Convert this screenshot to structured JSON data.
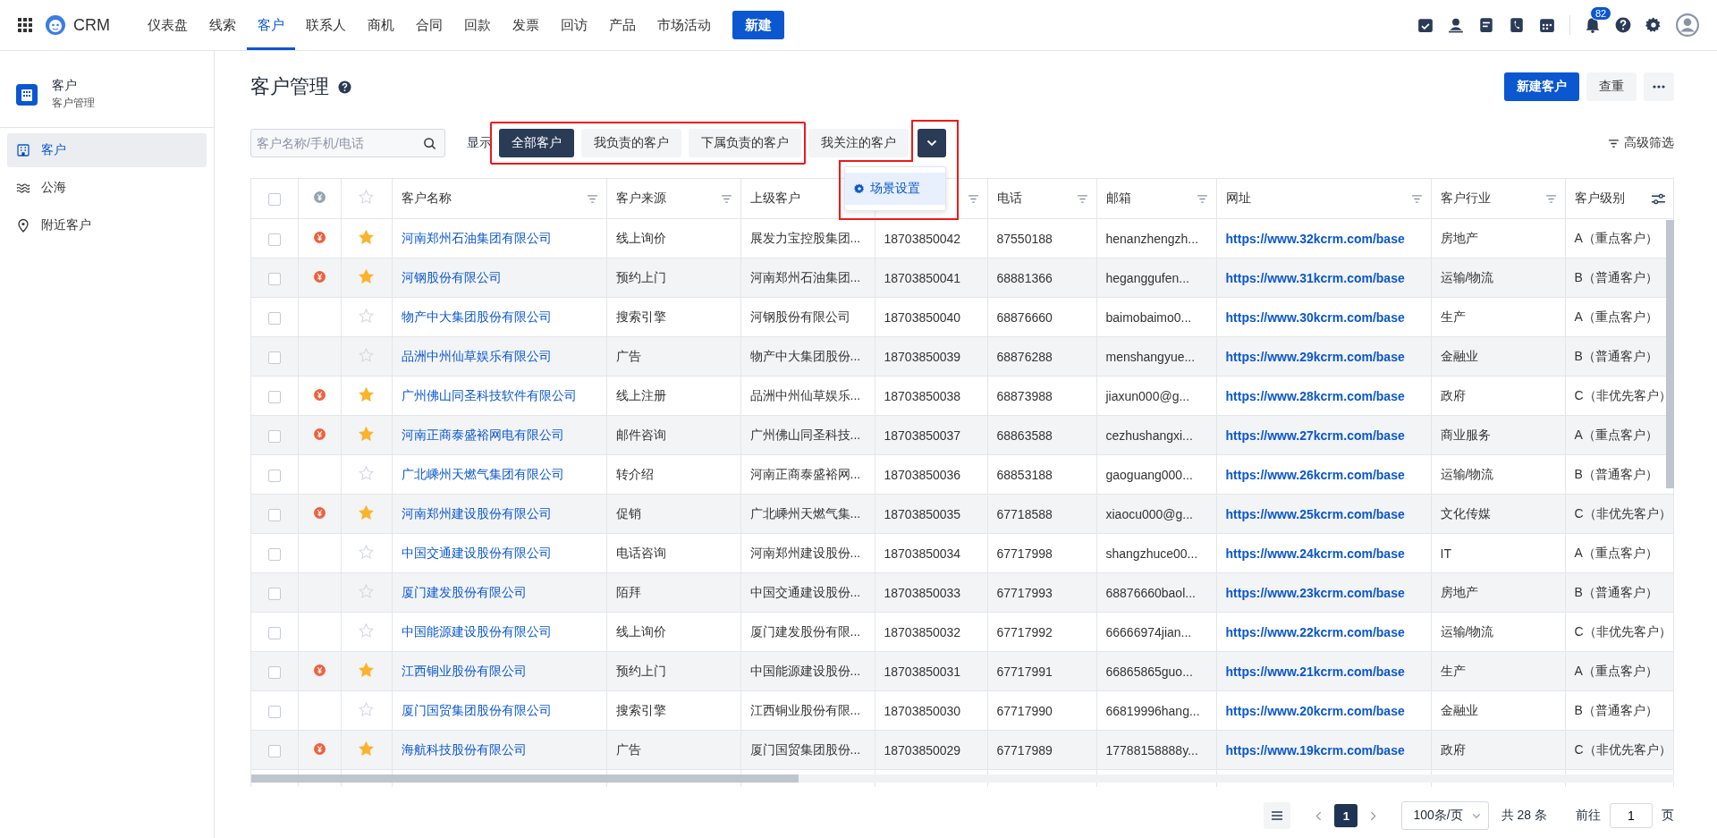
{
  "topbar": {
    "brand": "CRM",
    "nav": [
      {
        "label": "仪表盘",
        "selected": false
      },
      {
        "label": "线索",
        "selected": false
      },
      {
        "label": "客户",
        "selected": true
      },
      {
        "label": "联系人",
        "selected": false
      },
      {
        "label": "商机",
        "selected": false
      },
      {
        "label": "合同",
        "selected": false
      },
      {
        "label": "回款",
        "selected": false
      },
      {
        "label": "发票",
        "selected": false
      },
      {
        "label": "回访",
        "selected": false
      },
      {
        "label": "产品",
        "selected": false
      },
      {
        "label": "市场活动",
        "selected": false
      }
    ],
    "create_button": "新建",
    "notification_count": "82"
  },
  "sidebar": {
    "title": "客户",
    "subtitle": "客户管理",
    "items": [
      {
        "label": "客户",
        "kind": "building",
        "selected": true
      },
      {
        "label": "公海",
        "kind": "waves",
        "selected": false
      },
      {
        "label": "附近客户",
        "kind": "pin",
        "selected": false
      }
    ]
  },
  "header": {
    "title": "客户管理",
    "buttons": [
      {
        "label": "新建客户",
        "kind": "primary"
      },
      {
        "label": "查重",
        "kind": "plain"
      }
    ]
  },
  "filters": {
    "search_placeholder": "客户名称/手机/电话",
    "show_label": "显示",
    "scenes": [
      {
        "label": "全部客户",
        "selected": true
      },
      {
        "label": "我负责的客户",
        "selected": false
      },
      {
        "label": "下属负责的客户",
        "selected": false
      },
      {
        "label": "我关注的客户",
        "selected": false
      }
    ],
    "scene_menu": [
      "场景设置"
    ],
    "advanced_filter": "高级筛选"
  },
  "table": {
    "select_all_checked": false,
    "columns": [
      {
        "label": "客户名称",
        "filter": true
      },
      {
        "label": "客户来源",
        "filter": true
      },
      {
        "label": "上级客户",
        "filter": false
      },
      {
        "filter": true
      },
      {
        "label": "电话",
        "filter": true
      },
      {
        "label": "邮箱",
        "filter": true
      },
      {
        "label": "网址",
        "filter": true
      },
      {
        "label": "客户行业",
        "filter": true
      },
      {
        "label": "客户级别",
        "filter": false
      }
    ],
    "rows": [
      {
        "checked": false,
        "deal": true,
        "starred": true,
        "cells": [
          "河南郑州石油集团有限公司",
          "线上询价",
          "展发力宝控股集团...",
          "18703850042",
          "87550188",
          "henanzhengzh...",
          "https://www.32kcrm.com/base",
          "房地产",
          "A（重点客户）"
        ]
      },
      {
        "checked": false,
        "deal": true,
        "starred": true,
        "cells": [
          "河钢股份有限公司",
          "预约上门",
          "河南郑州石油集团...",
          "18703850041",
          "68881366",
          "heganggufen...",
          "https://www.31kcrm.com/base",
          "运输/物流",
          "B（普通客户）"
        ]
      },
      {
        "checked": false,
        "deal": false,
        "starred": false,
        "cells": [
          "物产中大集团股份有限公司",
          "搜索引擎",
          "河钢股份有限公司",
          "18703850040",
          "68876660",
          "baimobaimo0...",
          "https://www.30kcrm.com/base",
          "生产",
          "A（重点客户）"
        ]
      },
      {
        "checked": false,
        "deal": false,
        "starred": false,
        "cells": [
          "品洲中州仙草娱乐有限公司",
          "广告",
          "物产中大集团股份...",
          "18703850039",
          "68876288",
          "menshangyue...",
          "https://www.29kcrm.com/base",
          "金融业",
          "B（普通客户）"
        ]
      },
      {
        "checked": false,
        "deal": true,
        "starred": true,
        "cells": [
          "广州佛山同圣科技软件有限公司",
          "线上注册",
          "品洲中州仙草娱乐...",
          "18703850038",
          "68873988",
          "jiaxun000@g...",
          "https://www.28kcrm.com/base",
          "政府",
          "C（非优先客户）"
        ]
      },
      {
        "checked": false,
        "deal": true,
        "starred": true,
        "cells": [
          "河南正商泰盛裕网电有限公司",
          "邮件咨询",
          "广州佛山同圣科技...",
          "18703850037",
          "68863588",
          "cezhushangxi...",
          "https://www.27kcrm.com/base",
          "商业服务",
          "A（重点客户）"
        ]
      },
      {
        "checked": false,
        "deal": false,
        "starred": false,
        "cells": [
          "广北嵊州天燃气集团有限公司",
          "转介绍",
          "河南正商泰盛裕网...",
          "18703850036",
          "68853188",
          "gaoguang000...",
          "https://www.26kcrm.com/base",
          "运输/物流",
          "B（普通客户）"
        ]
      },
      {
        "checked": false,
        "deal": true,
        "starred": true,
        "cells": [
          "河南郑州建设股份有限公司",
          "促销",
          "广北嵊州天燃气集...",
          "18703850035",
          "67718588",
          "xiaocu000@g...",
          "https://www.25kcrm.com/base",
          "文化传媒",
          "C（非优先客户）"
        ]
      },
      {
        "checked": false,
        "deal": false,
        "starred": false,
        "cells": [
          "中国交通建设股份有限公司",
          "电话咨询",
          "河南郑州建设股份...",
          "18703850034",
          "67717998",
          "shangzhuce00...",
          "https://www.24kcrm.com/base",
          "IT",
          "A（重点客户）"
        ]
      },
      {
        "checked": false,
        "deal": false,
        "starred": false,
        "cells": [
          "厦门建发股份有限公司",
          "陌拜",
          "中国交通建设股份...",
          "18703850033",
          "67717993",
          "68876660baol...",
          "https://www.23kcrm.com/base",
          "房地产",
          "B（普通客户）"
        ]
      },
      {
        "checked": false,
        "deal": false,
        "starred": false,
        "cells": [
          "中国能源建设股份有限公司",
          "线上询价",
          "厦门建发股份有限...",
          "18703850032",
          "67717992",
          "66666974jian...",
          "https://www.22kcrm.com/base",
          "运输/物流",
          "C（非优先客户）"
        ]
      },
      {
        "checked": false,
        "deal": true,
        "starred": true,
        "cells": [
          "江西铜业股份有限公司",
          "预约上门",
          "中国能源建设股份...",
          "18703850031",
          "67717991",
          "66865865guo...",
          "https://www.21kcrm.com/base",
          "生产",
          "A（重点客户）"
        ]
      },
      {
        "checked": false,
        "deal": false,
        "starred": false,
        "cells": [
          "厦门国贸集团股份有限公司",
          "搜索引擎",
          "江西铜业股份有限...",
          "18703850030",
          "67717990",
          "66819996hang...",
          "https://www.20kcrm.com/base",
          "金融业",
          "B（普通客户）"
        ]
      },
      {
        "checked": false,
        "deal": true,
        "starred": true,
        "cells": [
          "海航科技股份有限公司",
          "广告",
          "厦门国贸集团股份...",
          "18703850029",
          "67717989",
          "17788158888y...",
          "https://www.19kcrm.com/base",
          "政府",
          "C（非优先客户）"
        ]
      }
    ]
  },
  "pagination": {
    "pages": [
      {
        "label": "1",
        "selected": true
      }
    ],
    "page_size": "100条/页",
    "total": "共 28 条",
    "goto_label": "前往",
    "goto_value": "1",
    "goto_suffix": "页"
  }
}
